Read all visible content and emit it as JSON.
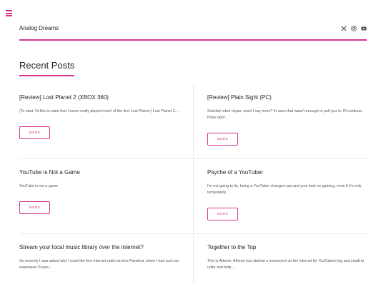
{
  "site": {
    "title": "Analog Dreams"
  },
  "icons": {
    "menu": "hamburger-icon",
    "social": [
      "x-icon",
      "instagram-icon",
      "youtube-icon"
    ]
  },
  "colors": {
    "accent": "#d6338a"
  },
  "section": {
    "title": "Recent Posts"
  },
  "posts": [
    {
      "title": "[Review] Lost Planet 2 (XBOX 360)",
      "excerpt": "(To start, I'd like to state that I never really played much of the first Lost Planet.) Lost Planet 2…",
      "button": "MORE"
    },
    {
      "title": "[Review] Plain Sight (PC)",
      "excerpt": "Suicidal robot ninjas, need I say more? In case that wasn't enough to pull you in, I'll continue. Plain sight…",
      "button": "MORE"
    },
    {
      "title": "YouTube is Not a Game",
      "excerpt": "YouTube is not a game",
      "button": "MORE"
    },
    {
      "title": "Psyche of a YouTuber",
      "excerpt": "I'm not going to lie, being a YouTuber changes you and your look on gaming, even if it's only temporarily.",
      "button": "MORE"
    },
    {
      "title": "Stream your local music library over the internet?",
      "excerpt": "So recently I was asked why I used the free internet radio service Pandora, when I had such an expansive iTunes…",
      "button": ""
    },
    {
      "title": "Together to the Top",
      "excerpt": "This is Athene. Athene has started a movement on the internet for YouTubers big and small to unite and help…",
      "button": ""
    }
  ]
}
